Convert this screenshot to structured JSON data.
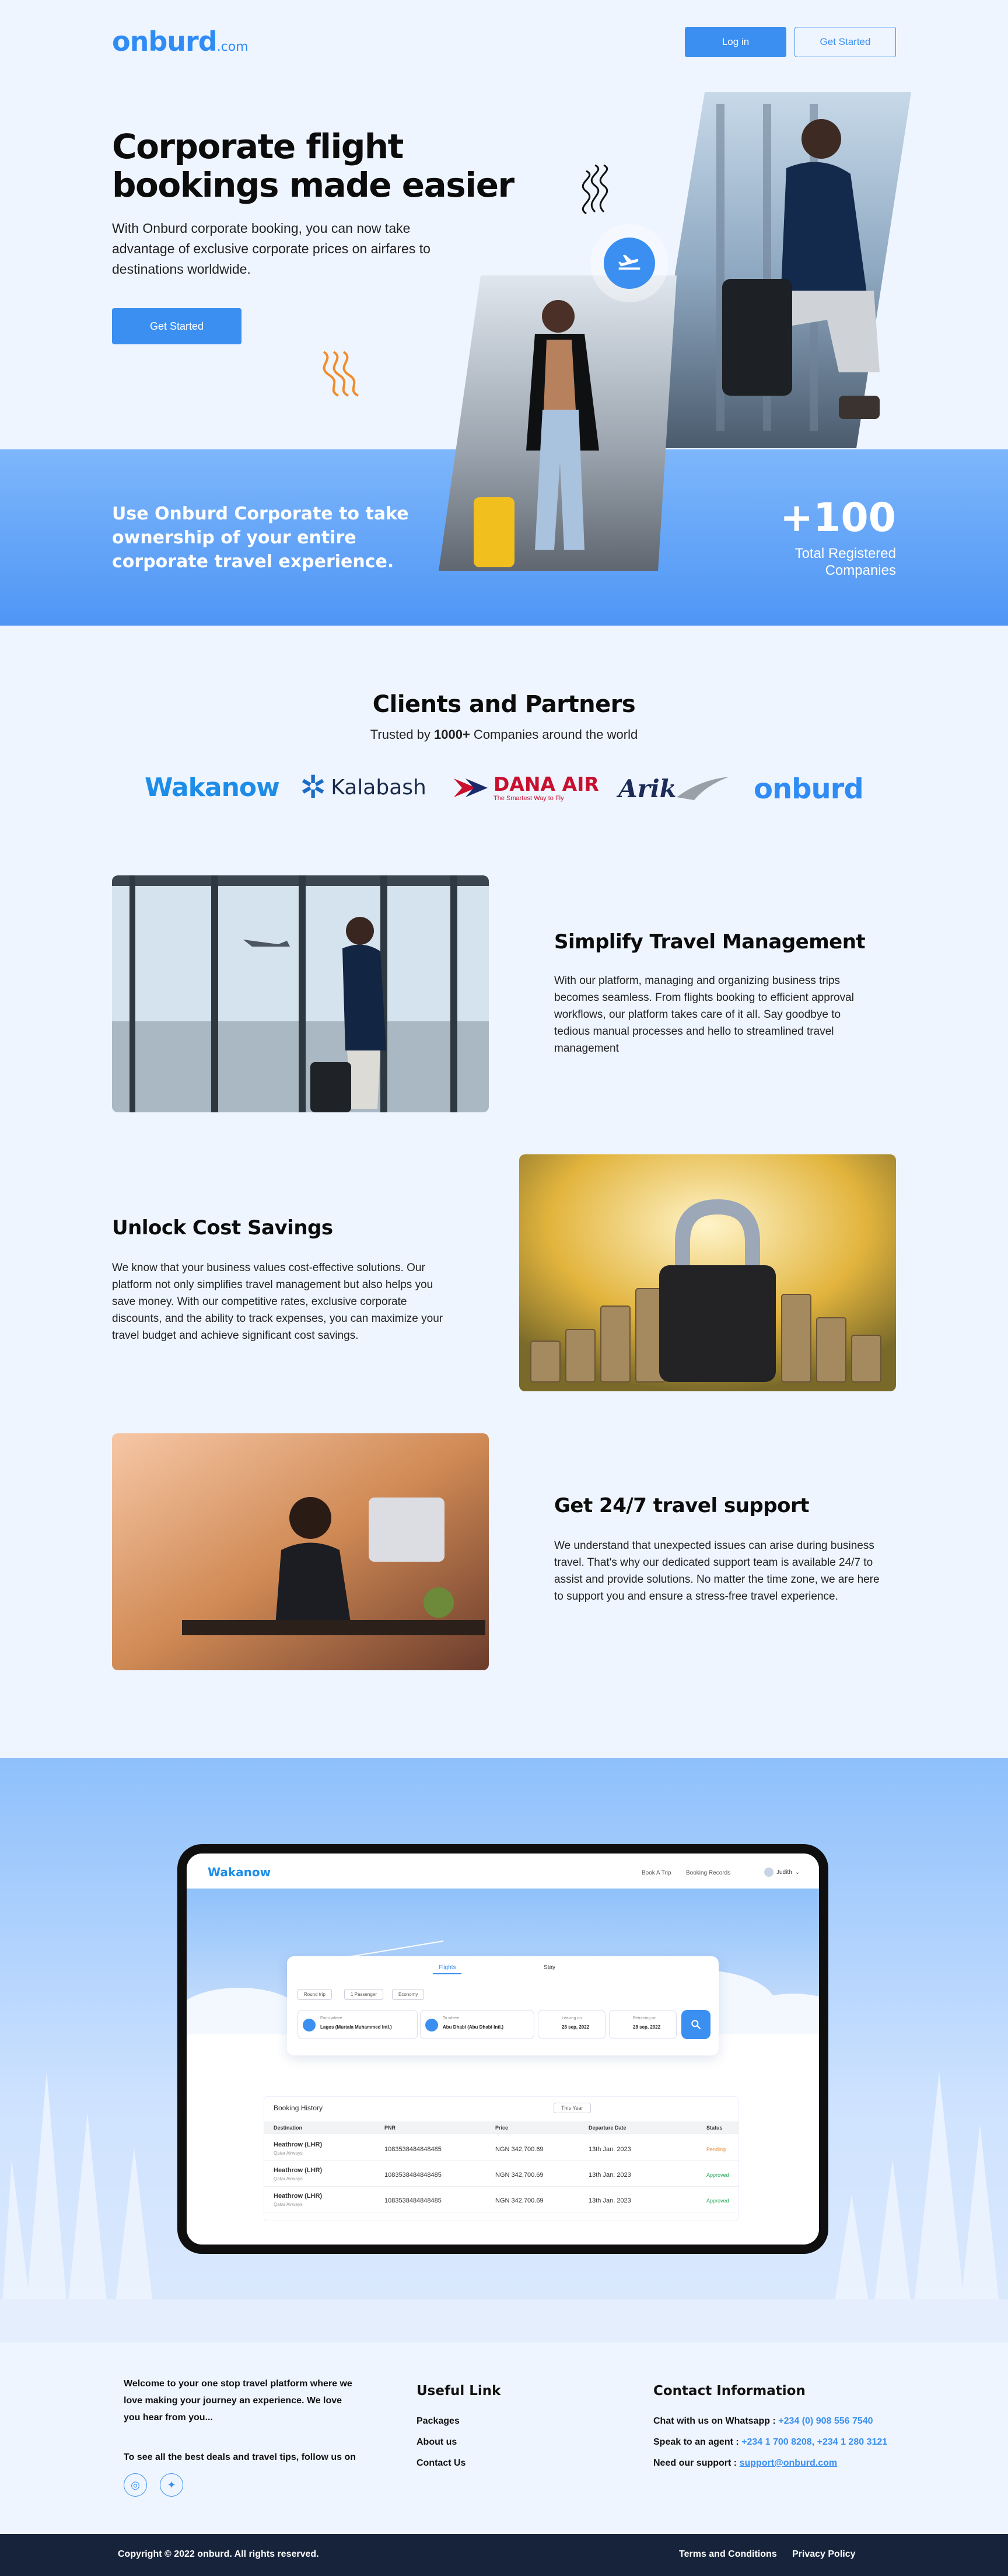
{
  "header": {
    "logo_main": "onburd",
    "logo_suffix": ".com",
    "login_label": "Log in",
    "get_started_label": "Get Started"
  },
  "hero": {
    "title_line1": "Corporate flight",
    "title_line2": "bookings made easier",
    "text": "With Onburd corporate booking, you can now take advantage of exclusive corporate prices on airfares to destinations worldwide.",
    "cta_label": "Get Started"
  },
  "band": {
    "text": "Use Onburd Corporate to take ownership of your entire corporate travel experience.",
    "stat_value": "+100",
    "stat_label_line1": "Total Registered",
    "stat_label_line2": "Companies"
  },
  "clients": {
    "title": "Clients and Partners",
    "subtitle_pre": "Trusted by ",
    "subtitle_bold": "1000+",
    "subtitle_post": " Companies around the world",
    "logos": [
      "Wakanow",
      "Kalabash",
      "DANA AIR",
      "The Smartest Way to Fly",
      "Arik",
      "onburd"
    ]
  },
  "features": [
    {
      "title": "Simplify Travel Management",
      "text": "With our platform, managing and organizing business trips becomes seamless. From flights booking to efficient approval workflows, our platform takes care of it all. Say goodbye to tedious manual processes and hello to streamlined travel management"
    },
    {
      "title": "Unlock Cost Savings",
      "text": "We know that your business values cost-effective solutions. Our platform not only simplifies travel management but also helps you save money. With our competitive rates, exclusive corporate discounts, and the ability to track expenses, you can maximize your travel budget and achieve significant cost savings."
    },
    {
      "title": "Get 24/7 travel support",
      "text": "We understand that unexpected issues can arise during business travel. That's why our dedicated support team is available 24/7 to assist and provide solutions. No matter the time zone, we are here to support you and ensure a stress-free travel experience."
    }
  ],
  "app": {
    "logo": "Wakanow",
    "nav": [
      "Book A Trip",
      "Booking Records"
    ],
    "user": "Judith",
    "tabs": [
      "Flights",
      "Stay"
    ],
    "chips": [
      "Round trip",
      "1 Passenger",
      "Economy"
    ],
    "from_label": "From where",
    "from_value": "Lagos (Murtala Muhammed Intl.)",
    "to_label": "To where",
    "to_value": "Abu Dhabi (Abu Dhabi Intl.)",
    "leaving_label": "Leaving on",
    "leaving_value": "28 sep, 2022",
    "returning_label": "Returning on",
    "returning_value": "28 sep, 2022",
    "history_title": "Booking History",
    "history_filter": "This Year",
    "columns": [
      "Destination",
      "PNR",
      "Price",
      "Departure Date",
      "Status"
    ],
    "rows": [
      {
        "dest": "Heathrow (LHR)",
        "sub": "Qatar Airways",
        "pnr": "1083538484848485",
        "price": "NGN 342,700.69",
        "date": "13th Jan. 2023",
        "status": "Pending",
        "color": "#e98a2b"
      },
      {
        "dest": "Heathrow (LHR)",
        "sub": "Qatar Airways",
        "pnr": "1083538484848485",
        "price": "NGN 342,700.69",
        "date": "13th Jan. 2023",
        "status": "Approved",
        "color": "#27a85c"
      },
      {
        "dest": "Heathrow (LHR)",
        "sub": "Qatar Airways",
        "pnr": "1083538484848485",
        "price": "NGN 342,700.69",
        "date": "13th Jan. 2023",
        "status": "Approved",
        "color": "#27a85c"
      }
    ]
  },
  "footer": {
    "welcome": "Welcome to your one stop travel platform where we love making your journey an experience. We love you hear from you...",
    "follow": "To see all the best deals and travel tips, follow us on",
    "useful_title": "Useful Link",
    "links": [
      "Packages",
      "About us",
      "Contact Us"
    ],
    "contact_title": "Contact Information",
    "whatsapp_label": "Chat with us on Whatsapp : ",
    "whatsapp_value": "+234 (0) 908 556 7540",
    "agent_label": "Speak to an agent : ",
    "agent_value": "+234 1 700 8208, +234 1 280 3121",
    "support_label": "Need our support : ",
    "support_value": "support@onburd.com",
    "copyright": "Copyright © 2022 onburd. All rights reserved.",
    "terms": "Terms and Conditions",
    "privacy": "Privacy Policy"
  },
  "colors": {
    "brand": "#3a8ff0",
    "accent": "#f28c28",
    "dark": "#17233a"
  },
  "icons": [
    "plane-icon",
    "instagram-icon",
    "twitter-icon",
    "search-icon",
    "wave-decoration"
  ]
}
